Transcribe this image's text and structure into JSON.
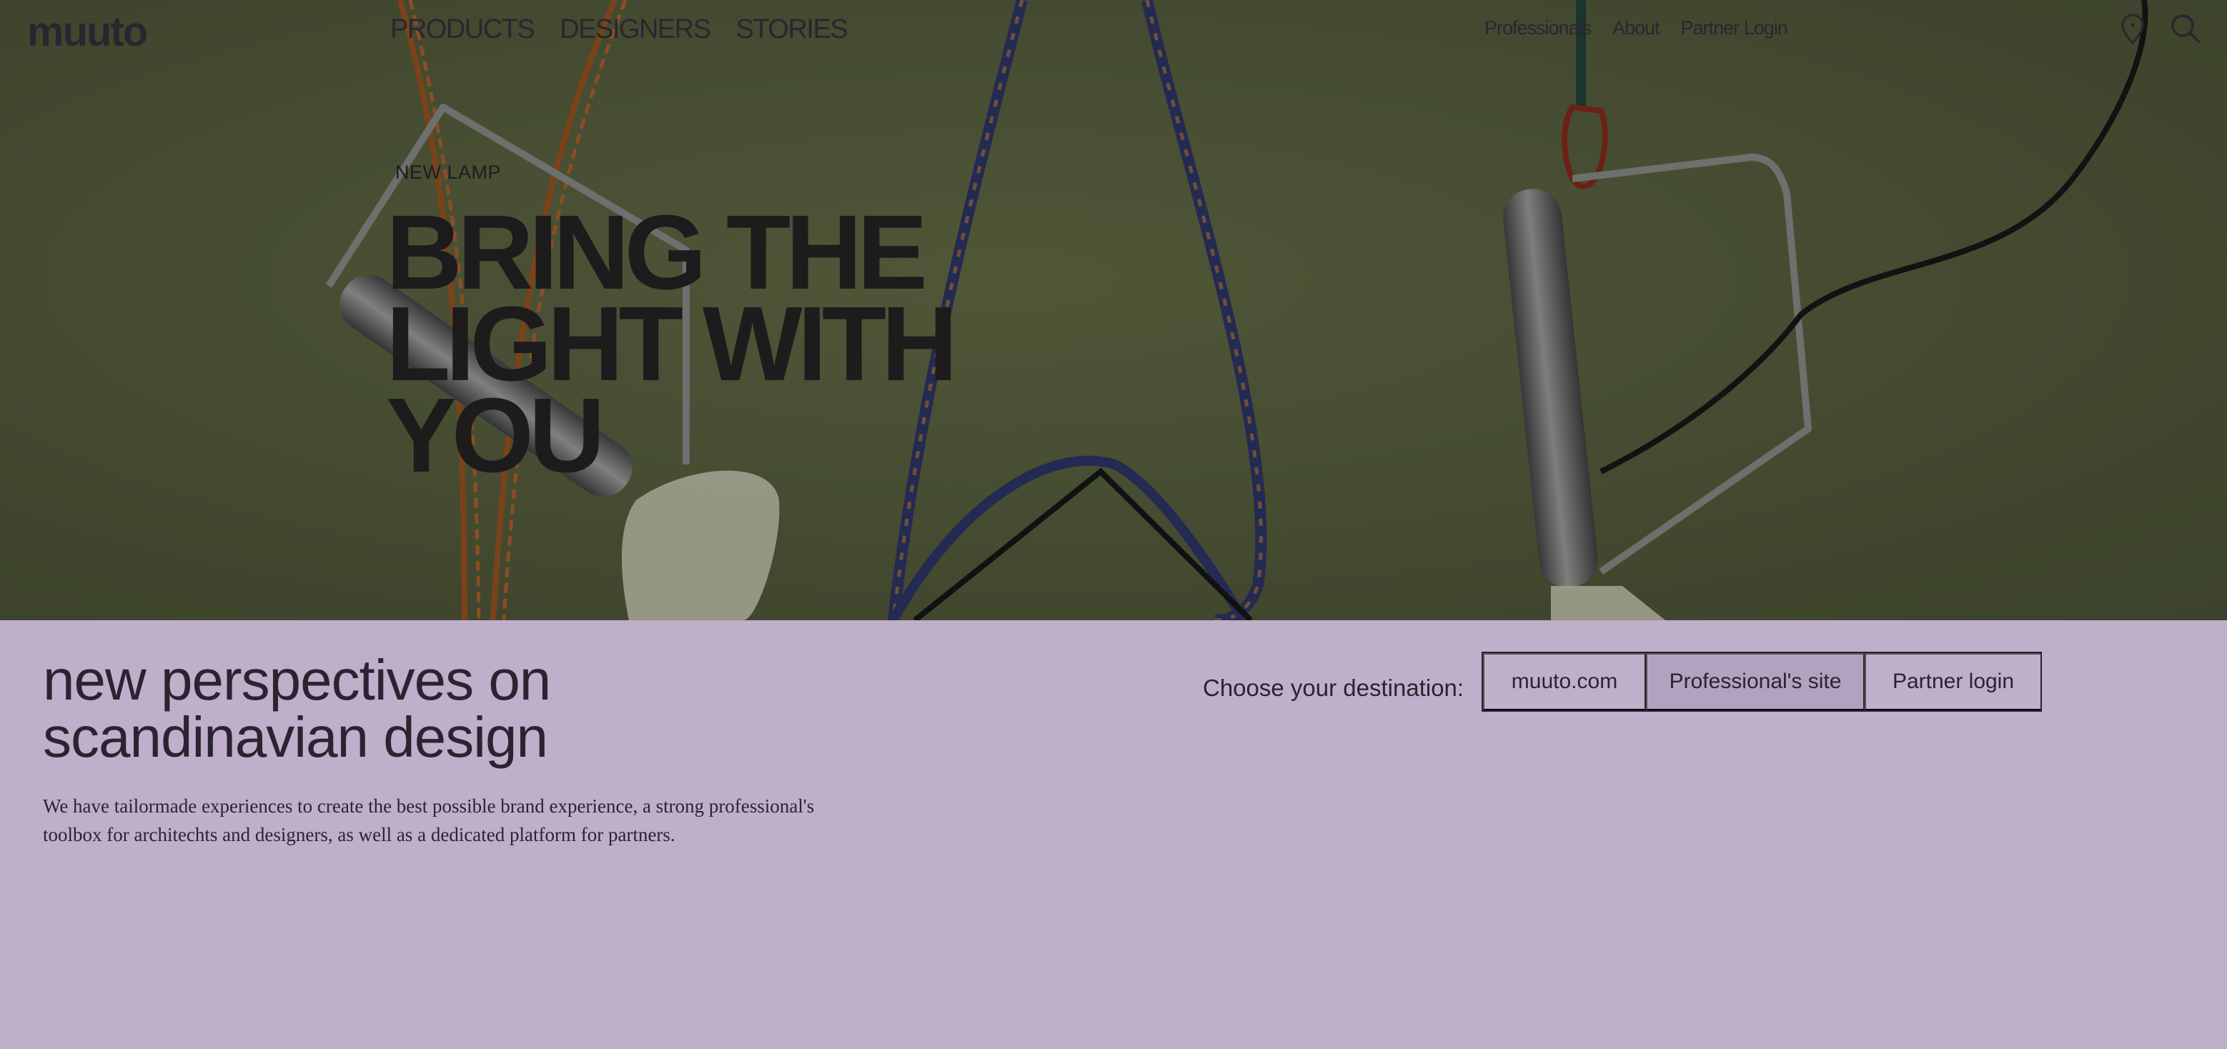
{
  "brand": {
    "logo_text": "muuto",
    "colors": {
      "hero_bg": "#4f5638",
      "panel_bg": "#bfafca",
      "text_dark": "#2b2430",
      "selected_button_bg": "#b3a2bf"
    }
  },
  "header": {
    "main_nav": [
      {
        "label": "PRODUCTS"
      },
      {
        "label": "DESIGNERS"
      },
      {
        "label": "STORIES"
      }
    ],
    "utility_nav": [
      {
        "label": "Professionals"
      },
      {
        "label": "About"
      },
      {
        "label": "Partner Login"
      }
    ],
    "icons": [
      "location-pin-icon",
      "search-icon"
    ]
  },
  "hero": {
    "eyebrow": "NEW LAMP",
    "headline_lines": [
      "BRING THE",
      "LIGHT WITH",
      "YOU"
    ]
  },
  "panel": {
    "tagline_lines": [
      "new perspectives on",
      "scandinavian design"
    ],
    "intro": "We have tailormade experiences to create the best possible brand experience, a strong professional's toolbox for architechts and designers, as well as a dedicated platform for partners.",
    "destination_label": "Choose your destination:",
    "destinations": [
      {
        "label": "muuto.com"
      },
      {
        "label": "Professional's site",
        "selected": true
      },
      {
        "label": "Partner login"
      }
    ]
  }
}
